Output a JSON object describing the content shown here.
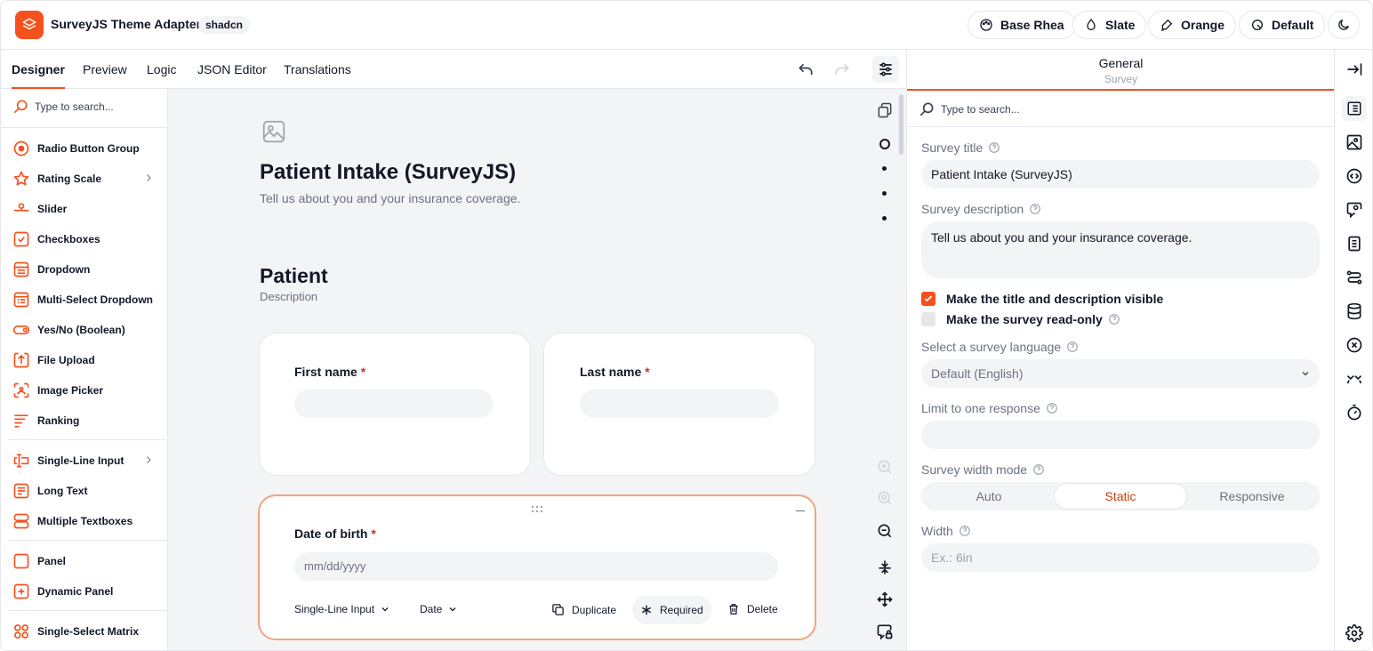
{
  "app": {
    "title": "SurveyJS Theme Adapter",
    "badge": "shadcn"
  },
  "header": {
    "theme_buttons": [
      {
        "label": "Base Rhea",
        "icon": "palette-icon"
      },
      {
        "label": "Slate",
        "icon": "drop-icon"
      },
      {
        "label": "Orange",
        "icon": "brush-icon"
      },
      {
        "label": "Default",
        "icon": "radius-icon"
      }
    ],
    "dark_mode_icon": "moon-icon"
  },
  "tabs": [
    "Designer",
    "Preview",
    "Logic",
    "JSON Editor",
    "Translations"
  ],
  "active_tab": "Designer",
  "toolbox": {
    "search_placeholder": "Type to search...",
    "items": [
      {
        "label": "Radio Button Group",
        "icon": "radio-icon"
      },
      {
        "label": "Rating Scale",
        "icon": "star-icon",
        "has_submenu": true
      },
      {
        "label": "Slider",
        "icon": "slider-icon"
      },
      {
        "label": "Checkboxes",
        "icon": "checkbox-icon"
      },
      {
        "label": "Dropdown",
        "icon": "dropdown-icon"
      },
      {
        "label": "Multi-Select Dropdown",
        "icon": "multi-dropdown-icon"
      },
      {
        "label": "Yes/No (Boolean)",
        "icon": "toggle-icon"
      },
      {
        "label": "File Upload",
        "icon": "upload-icon"
      },
      {
        "label": "Image Picker",
        "icon": "image-picker-icon"
      },
      {
        "label": "Ranking",
        "icon": "ranking-icon"
      },
      {
        "label": "Single-Line Input",
        "icon": "text-input-icon",
        "has_submenu": true
      },
      {
        "label": "Long Text",
        "icon": "long-text-icon"
      },
      {
        "label": "Multiple Textboxes",
        "icon": "multi-text-icon"
      },
      {
        "label": "Panel",
        "icon": "panel-icon"
      },
      {
        "label": "Dynamic Panel",
        "icon": "dynamic-panel-icon"
      },
      {
        "label": "Single-Select Matrix",
        "icon": "matrix-icon"
      }
    ]
  },
  "survey": {
    "title": "Patient Intake (SurveyJS)",
    "description": "Tell us about you and your insurance coverage.",
    "page_title": "Patient",
    "page_description": "Description",
    "questions": [
      {
        "label": "First name",
        "required_mark": "*"
      },
      {
        "label": "Last name",
        "required_mark": "*"
      },
      {
        "label": "Date of birth",
        "required_mark": "*",
        "placeholder": "mm/dd/yyyy"
      }
    ],
    "question_toolbar": {
      "type_select": "Single-Line Input",
      "input_type_select": "Date",
      "duplicate": "Duplicate",
      "required": "Required",
      "delete": "Delete"
    }
  },
  "properties": {
    "title": "General",
    "subtitle": "Survey",
    "search_placeholder": "Type to search...",
    "survey_title_label": "Survey title",
    "survey_title_value": "Patient Intake (SurveyJS)",
    "survey_description_label": "Survey description",
    "survey_description_value": "Tell us about you and your insurance coverage.",
    "check_visible_label": "Make the title and description visible",
    "check_visible_checked": true,
    "check_readonly_label": "Make the survey read-only",
    "check_readonly_checked": false,
    "language_label": "Select a survey language",
    "language_value": "Default (English)",
    "limit_label": "Limit to one response",
    "limit_value": "",
    "width_mode_label": "Survey width mode",
    "width_mode_options": [
      "Auto",
      "Static",
      "Responsive"
    ],
    "width_mode_selected": "Static",
    "width_label": "Width",
    "width_placeholder": "Ex.: 6in"
  },
  "colors": {
    "accent": "#f4511e",
    "selected_border": "#f2a37e",
    "required_star": "#dc2626"
  }
}
